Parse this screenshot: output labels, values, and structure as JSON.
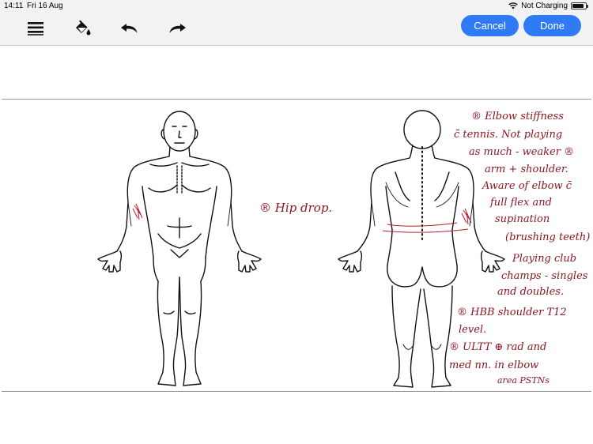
{
  "status": {
    "time": "14:11",
    "date": "Fri 16 Aug",
    "charging": "Not Charging",
    "battery_level": 0.85
  },
  "toolbar": {
    "icons": [
      "menu-icon",
      "paint-bucket-icon",
      "undo-icon",
      "redo-icon"
    ],
    "cancel_label": "Cancel",
    "done_label": "Done",
    "accent": "#2f7bf5"
  },
  "annotations": {
    "hip_drop": "® Hip drop.",
    "elbow": [
      "® Elbow stiffness",
      "c̄ tennis. Not playing",
      "as much - weaker ®",
      "arm + shoulder.",
      "Aware of elbow c̄",
      "full flex and",
      "supination",
      "(brushing teeth)",
      "Playing club",
      "champs - singles",
      "and doubles."
    ],
    "hbb": [
      "® HBB shoulder T12",
      "level."
    ],
    "ultt": [
      "® ULTT ⊕ rad and",
      "med nn. in elbow",
      "area PSTNs"
    ],
    "ink_color": "#8b1720"
  }
}
